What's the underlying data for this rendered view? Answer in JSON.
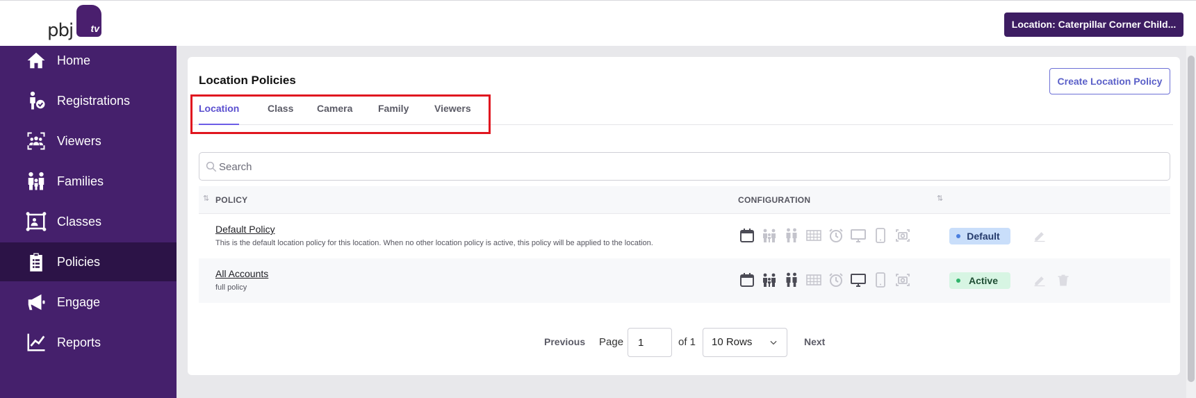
{
  "header": {
    "logo_text": "pbj",
    "logo_tv": "tv",
    "location_button": "Location: Caterpillar Corner Child..."
  },
  "sidebar": {
    "items": [
      {
        "label": "Home",
        "icon": "home-icon"
      },
      {
        "label": "Registrations",
        "icon": "registrations-icon"
      },
      {
        "label": "Viewers",
        "icon": "viewers-icon"
      },
      {
        "label": "Families",
        "icon": "families-icon"
      },
      {
        "label": "Classes",
        "icon": "classes-icon"
      },
      {
        "label": "Policies",
        "icon": "clipboard-icon",
        "active": true
      },
      {
        "label": "Engage",
        "icon": "megaphone-icon"
      },
      {
        "label": "Reports",
        "icon": "chart-line-icon"
      }
    ]
  },
  "main": {
    "title": "Location Policies",
    "create_button": "Create Location Policy",
    "tabs": [
      {
        "label": "Location",
        "active": true
      },
      {
        "label": "Class"
      },
      {
        "label": "Camera"
      },
      {
        "label": "Family"
      },
      {
        "label": "Viewers"
      }
    ],
    "search": {
      "placeholder": "Search",
      "value": ""
    },
    "table": {
      "headers": {
        "policy": "POLICY",
        "configuration": "CONFIGURATION"
      },
      "rows": [
        {
          "name": "Default Policy",
          "description": "This is the default location policy for this location. When no other location policy is active, this policy will be applied to the location.",
          "status": "Default",
          "config_enabled": [
            true,
            false,
            false,
            false,
            false,
            false,
            false,
            false
          ]
        },
        {
          "name": "All Accounts",
          "description": "full policy",
          "status": "Active",
          "config_enabled": [
            true,
            true,
            true,
            false,
            false,
            true,
            false,
            false
          ]
        }
      ],
      "config_icons": [
        "calendar-icon",
        "family-group-icon",
        "couple-icon",
        "grid-icon",
        "alarm-clock-icon",
        "monitor-icon",
        "phone-icon",
        "camera-icon"
      ]
    },
    "pagination": {
      "previous": "Previous",
      "page_label": "Page",
      "page_value": "1",
      "of_label": "of 1",
      "rows_option": "10 Rows",
      "next": "Next"
    }
  },
  "colors": {
    "sidebar_bg": "#45206c",
    "sidebar_active": "#2c1347",
    "accent": "#5a4fcf",
    "highlight": "#e0161f",
    "icon_enabled": "#4b4b55",
    "icon_disabled": "#c4c4cc"
  }
}
